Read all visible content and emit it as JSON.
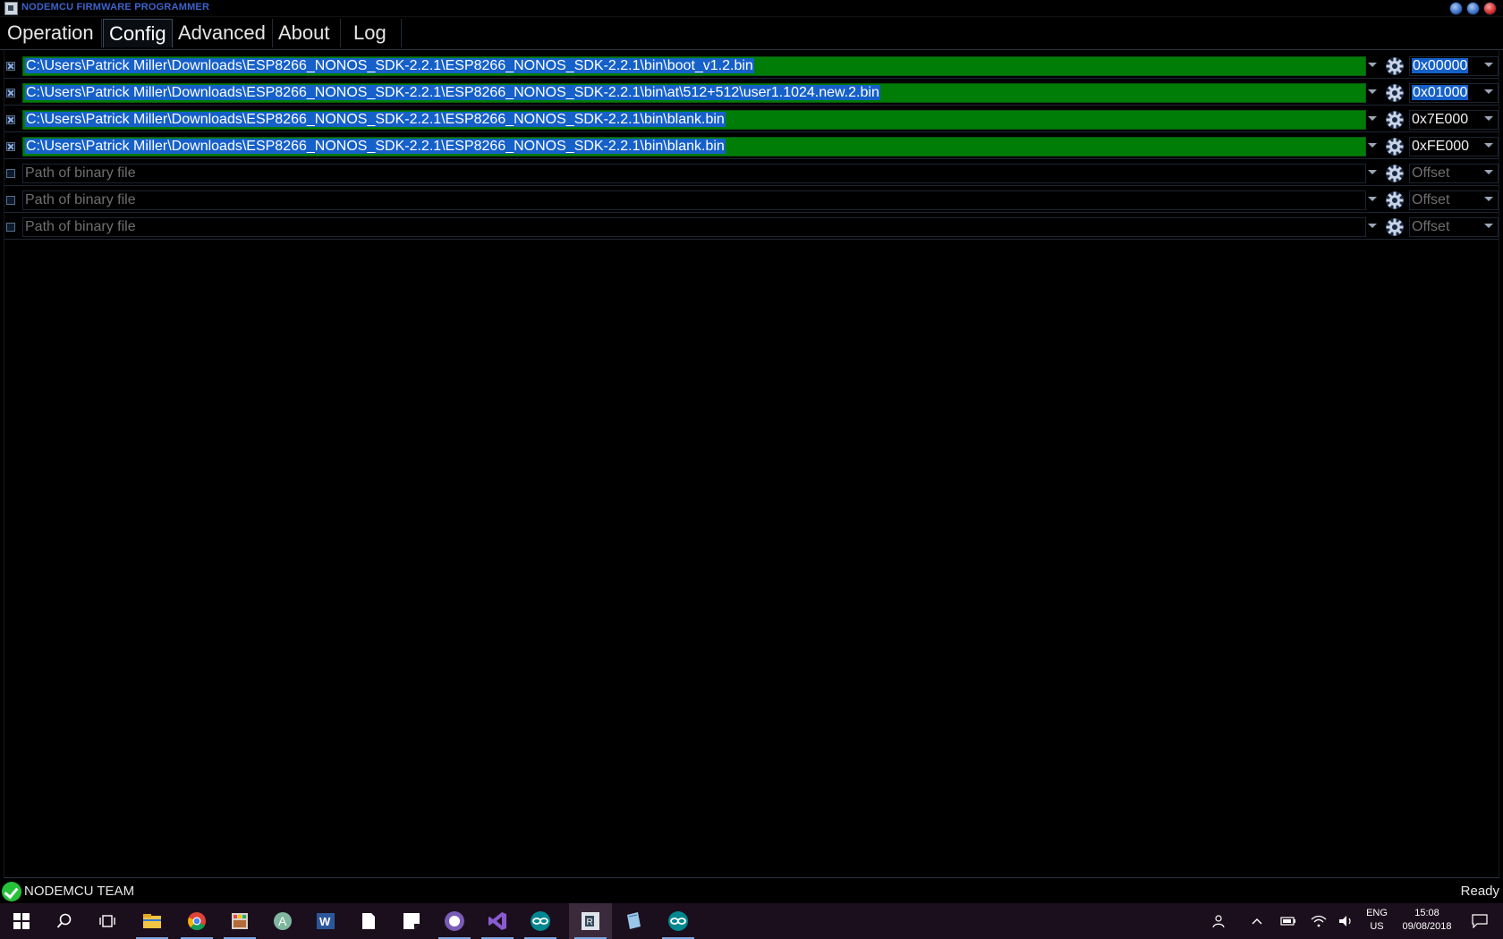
{
  "window": {
    "title": "NODEMCU FIRMWARE PROGRAMMER"
  },
  "tabs": [
    {
      "label": "Operation",
      "active": false
    },
    {
      "label": "Config",
      "active": true
    },
    {
      "label": "Advanced",
      "active": false
    },
    {
      "label": "About",
      "active": false
    },
    {
      "label": "Log",
      "active": false
    }
  ],
  "rows": [
    {
      "checked": true,
      "path": "C:\\Users\\Patrick Miller\\Downloads\\ESP8266_NONOS_SDK-2.2.1\\ESP8266_NONOS_SDK-2.2.1\\bin\\boot_v1.2.bin",
      "offset": "0x00000"
    },
    {
      "checked": true,
      "path": "C:\\Users\\Patrick Miller\\Downloads\\ESP8266_NONOS_SDK-2.2.1\\ESP8266_NONOS_SDK-2.2.1\\bin\\at\\512+512\\user1.1024.new.2.bin",
      "offset": "0x01000"
    },
    {
      "checked": true,
      "path": "C:\\Users\\Patrick Miller\\Downloads\\ESP8266_NONOS_SDK-2.2.1\\ESP8266_NONOS_SDK-2.2.1\\bin\\blank.bin",
      "offset": "0x7E000"
    },
    {
      "checked": true,
      "path": "C:\\Users\\Patrick Miller\\Downloads\\ESP8266_NONOS_SDK-2.2.1\\ESP8266_NONOS_SDK-2.2.1\\bin\\blank.bin",
      "offset": "0xFE000"
    },
    {
      "checked": false,
      "path": "",
      "offset": ""
    },
    {
      "checked": false,
      "path": "",
      "offset": ""
    },
    {
      "checked": false,
      "path": "",
      "offset": ""
    }
  ],
  "placeholders": {
    "path": "Path of binary file",
    "offset": "Offset"
  },
  "status": {
    "team": "NODEMCU TEAM",
    "state": "Ready"
  },
  "taskbar": {
    "language": "ENG",
    "region": "US",
    "time": "15:08",
    "date": "09/08/2018",
    "apps": [
      "windows-start-icon",
      "search-icon",
      "task-view-icon",
      "file-explorer-icon",
      "chrome-icon",
      "paint-icon",
      "app-a-icon",
      "word-icon",
      "file-icon",
      "sticky-notes-icon",
      "github-desktop-icon",
      "visual-studio-icon",
      "arduino-icon",
      "nodemcu-flasher-icon",
      "notepad-icon",
      "arduino-icon"
    ]
  },
  "colors": {
    "filled_path_bg": "#007d07",
    "selection_bg": "#1560c9",
    "title_text": "#3d63c9",
    "taskbar_bg": "#1c0f1d"
  }
}
